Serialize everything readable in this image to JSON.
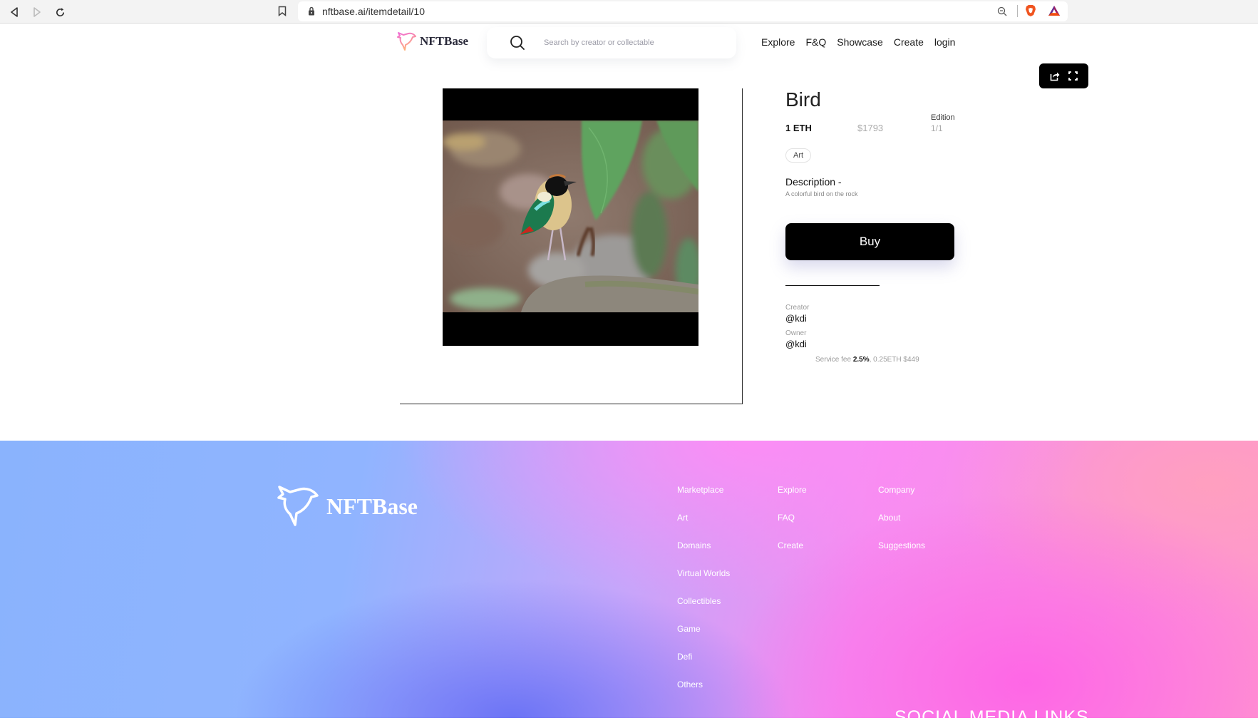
{
  "browser": {
    "url": "nftbase.ai/itemdetail/10",
    "icons": [
      "back-icon",
      "forward-icon",
      "reload-icon",
      "bookmark-icon",
      "lock-icon",
      "zoom-out-icon",
      "brave-shield-icon",
      "bat-rewards-icon"
    ]
  },
  "header": {
    "brand": "NFTBase",
    "search": {
      "placeholder": "Search by creator or collectable",
      "value": ""
    },
    "nav": [
      {
        "label": "Explore"
      },
      {
        "label": "F&Q"
      },
      {
        "label": "Showcase"
      },
      {
        "label": "Create"
      },
      {
        "label": "login"
      }
    ],
    "media_actions": [
      "share-icon",
      "fullscreen-icon"
    ]
  },
  "item": {
    "title": "Bird",
    "price_eth": "1 ETH",
    "price_usd": "$1793",
    "edition_label": "Edition",
    "edition_value": "1/1",
    "tag": "Art",
    "description_heading": "Description -",
    "description": "A colorful bird on the rock",
    "buy_label": "Buy",
    "creator_label": "Creator",
    "creator": "@kdi",
    "owner_label": "Owner",
    "owner": "@kdi",
    "service_fee_label": "Service fee",
    "service_fee_percent": "2.5%",
    "service_fee_amount": ", 0.25ETH $449",
    "image_alt": "Colorful pitta bird standing on a rock"
  },
  "footer": {
    "brand": "NFTBase",
    "columns": [
      {
        "links": [
          "Marketplace",
          "Art",
          "Domains",
          "Virtual Worlds",
          "Collectibles",
          "Game",
          "Defi",
          "Others"
        ]
      },
      {
        "links": [
          "Explore",
          "FAQ",
          "Create"
        ]
      },
      {
        "links": [
          "Company",
          "About",
          "Suggestions"
        ]
      }
    ],
    "social_heading": "SOCIAL MEDIA LINKS"
  },
  "colors": {
    "primary": "#000000",
    "footer_gradient": [
      "#8ab3fd",
      "#c7a5fa",
      "#f48df0",
      "#ff95cf"
    ],
    "muted_text": "#9a9a9a"
  }
}
